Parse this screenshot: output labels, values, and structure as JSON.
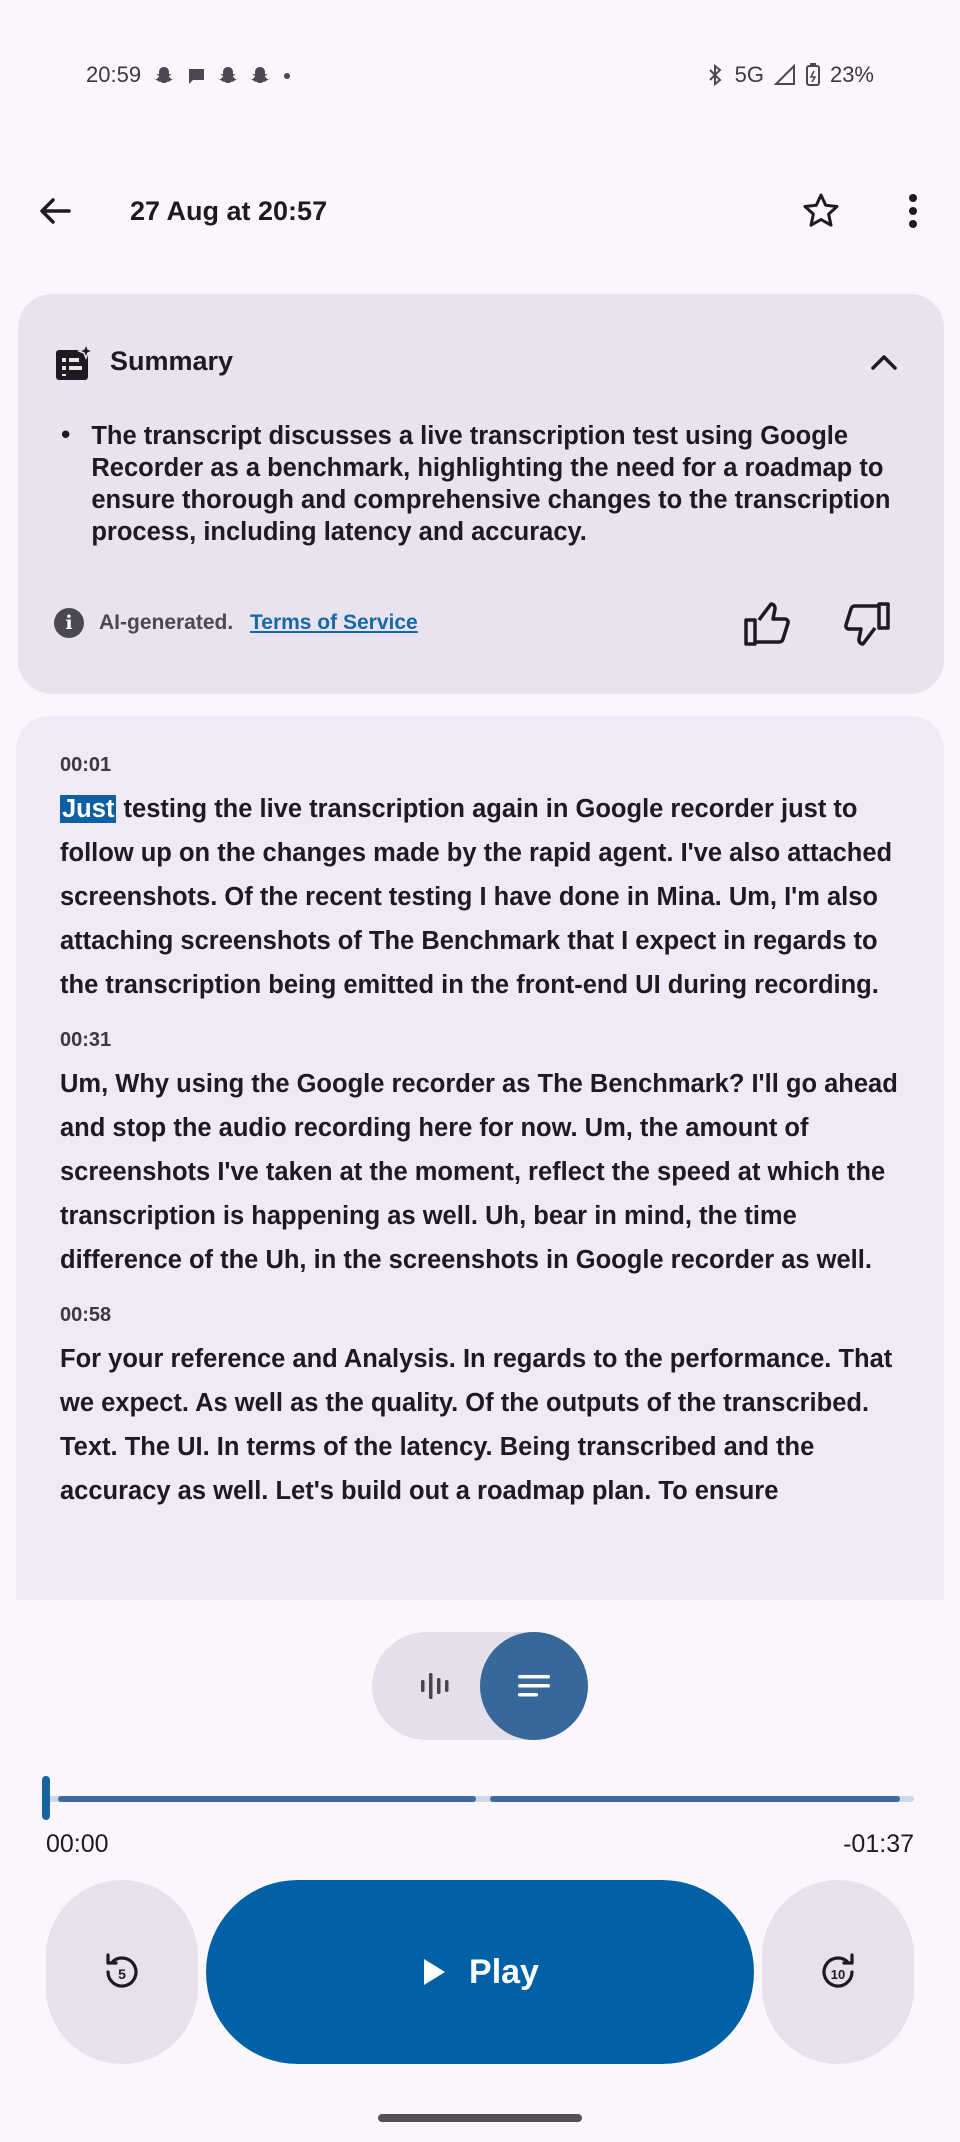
{
  "status": {
    "time": "20:59",
    "network": "5G",
    "battery": "23%"
  },
  "app_bar": {
    "title": "27 Aug at 20:57"
  },
  "summary": {
    "title": "Summary",
    "bullet": "The transcript discusses a live transcription test using Google Recorder as a benchmark, highlighting the need for a roadmap to ensure thorough and comprehensive changes to the transcription process, including latency and accuracy.",
    "ai_label": "AI-generated.",
    "tos_link": "Terms of Service"
  },
  "transcript": {
    "segments": [
      {
        "time": "00:01",
        "highlight": "Just",
        "text": " testing the live transcription again in Google recorder just to follow up on the changes made by the rapid agent. I've also attached screenshots. Of the recent testing I have done in Mina. Um, I'm also attaching screenshots of The Benchmark that I expect in regards to the transcription being emitted in the front-end UI during recording."
      },
      {
        "time": "00:31",
        "text": "Um, Why using the Google recorder as The Benchmark? I'll go ahead and stop the audio recording here for now. Um, the amount of screenshots I've taken at the moment, reflect the speed at which the transcription is happening as well. Uh, bear in mind, the time difference of the Uh, in the screenshots in Google recorder as well."
      },
      {
        "time": "00:58",
        "text": "For your reference and Analysis. In regards to the performance. That we expect. As well as the quality. Of the outputs of the transcribed. Text. The UI. In terms of the latency. Being transcribed and the accuracy as well. Let's build out a roadmap plan. To ensure"
      }
    ]
  },
  "player": {
    "current_time": "00:00",
    "remaining_time": "-01:37",
    "progress_fraction": 0.0,
    "play_label": "Play",
    "rewind_seconds": "5",
    "forward_seconds": "10"
  },
  "colors": {
    "accent": "#0061a6",
    "highlight": "#0b5fa2",
    "card": "#e9e3f0",
    "background": "#fbf6fc"
  }
}
